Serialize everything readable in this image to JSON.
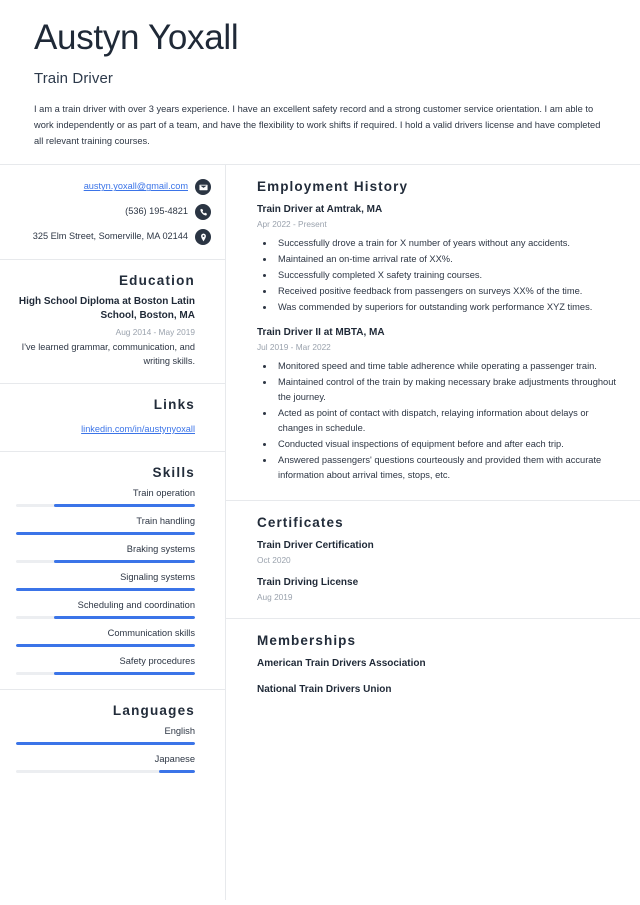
{
  "header": {
    "name": "Austyn Yoxall",
    "title": "Train Driver",
    "summary": "I am a train driver with over 3 years experience. I have an excellent safety record and a strong customer service orientation. I am able to work independently or as part of a team, and have the flexibility to work shifts if required. I hold a valid drivers license and have completed all relevant training courses."
  },
  "contact": {
    "email": "austyn.yoxall@gmail.com",
    "phone": "(536) 195-4821",
    "address": "325 Elm Street, Somerville, MA 02144",
    "email_icon": "envelope-icon",
    "phone_icon": "phone-icon",
    "address_icon": "map-pin-icon"
  },
  "education": {
    "heading": "Education",
    "items": [
      {
        "degree": "High School Diploma at Boston Latin School, Boston, MA",
        "date": "Aug 2014 - May 2019",
        "description": "I've learned grammar, communication, and writing skills."
      }
    ]
  },
  "links": {
    "heading": "Links",
    "items": [
      {
        "label": "linkedin.com/in/austynyoxall"
      }
    ]
  },
  "skills": {
    "heading": "Skills",
    "items": [
      {
        "label": "Train operation",
        "level": 79
      },
      {
        "label": "Train handling",
        "level": 100
      },
      {
        "label": "Braking systems",
        "level": 79
      },
      {
        "label": "Signaling systems",
        "level": 100
      },
      {
        "label": "Scheduling and coordination",
        "level": 79
      },
      {
        "label": "Communication skills",
        "level": 100
      },
      {
        "label": "Safety procedures",
        "level": 79
      }
    ]
  },
  "languages": {
    "heading": "Languages",
    "items": [
      {
        "label": "English",
        "level": 100
      },
      {
        "label": "Japanese",
        "level": 20
      }
    ]
  },
  "employment": {
    "heading": "Employment History",
    "entries": [
      {
        "title": "Train Driver at Amtrak, MA",
        "date": "Apr 2022 - Present",
        "bullets": [
          "Successfully drove a train for X number of years without any accidents.",
          "Maintained an on-time arrival rate of XX%.",
          "Successfully completed X safety training courses.",
          "Received positive feedback from passengers on surveys XX% of the time.",
          "Was commended by superiors for outstanding work performance XYZ times."
        ]
      },
      {
        "title": "Train Driver II at MBTA, MA",
        "date": "Jul 2019 - Mar 2022",
        "bullets": [
          "Monitored speed and time table adherence while operating a passenger train.",
          "Maintained control of the train by making necessary brake adjustments throughout the journey.",
          "Acted as point of contact with dispatch, relaying information about delays or changes in schedule.",
          "Conducted visual inspections of equipment before and after each trip.",
          "Answered passengers' questions courteously and provided them with accurate information about arrival times, stops, etc."
        ]
      }
    ]
  },
  "certificates": {
    "heading": "Certificates",
    "items": [
      {
        "name": "Train Driver Certification",
        "date": "Oct 2020"
      },
      {
        "name": "Train Driving License",
        "date": "Aug 2019"
      }
    ]
  },
  "memberships": {
    "heading": "Memberships",
    "items": [
      {
        "name": "American Train Drivers Association"
      },
      {
        "name": "National Train Drivers Union"
      }
    ]
  },
  "colors": {
    "accent": "#3b74e8",
    "heading": "#222c3a",
    "muted": "#9aa2ad",
    "track": "#eceef1",
    "icon_bg": "#2b3543"
  }
}
